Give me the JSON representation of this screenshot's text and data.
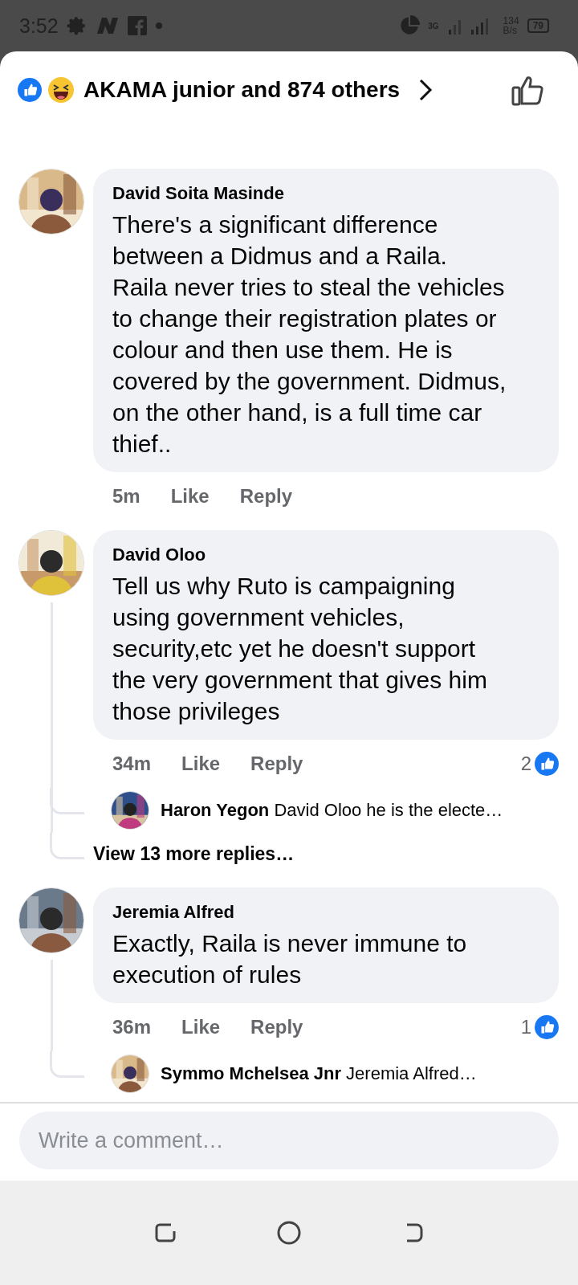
{
  "status_bar": {
    "time": "3:52",
    "network": "3G",
    "speed_value": "134",
    "speed_unit": "B/s",
    "battery": "79"
  },
  "header": {
    "reactions_summary": "AKAMA junior and 874 others"
  },
  "comments": [
    {
      "author": "David Soita Masinde",
      "text": "There's a significant difference between a Didmus and a Raila. Raila never tries to steal the vehicles to change their registration plates or colour and then use them. He is covered by the government. Didmus, on the other hand, is a full time car thief..",
      "time": "5m",
      "actions": [
        "Like",
        "Reply"
      ]
    },
    {
      "author": "David Oloo",
      "text": "Tell us why Ruto is campaigning using government vehicles, security,etc yet he doesn't support the very government that gives him those privileges",
      "time": "34m",
      "actions": [
        "Like",
        "Reply"
      ],
      "reaction_count": "2",
      "replies": [
        {
          "author": "Haron Yegon",
          "snippet": "David Oloo he is the electe…"
        }
      ],
      "more_replies": "View 13 more replies…"
    },
    {
      "author": "Jeremia Alfred",
      "text": "Exactly, Raila is never immune to execution of  rules",
      "time": "36m",
      "actions": [
        "Like",
        "Reply"
      ],
      "reaction_count": "1",
      "replies": [
        {
          "author": "Symmo Mchelsea Jnr",
          "snippet": "Jeremia Alfred…"
        }
      ]
    }
  ],
  "composer": {
    "placeholder": "Write a comment…"
  }
}
